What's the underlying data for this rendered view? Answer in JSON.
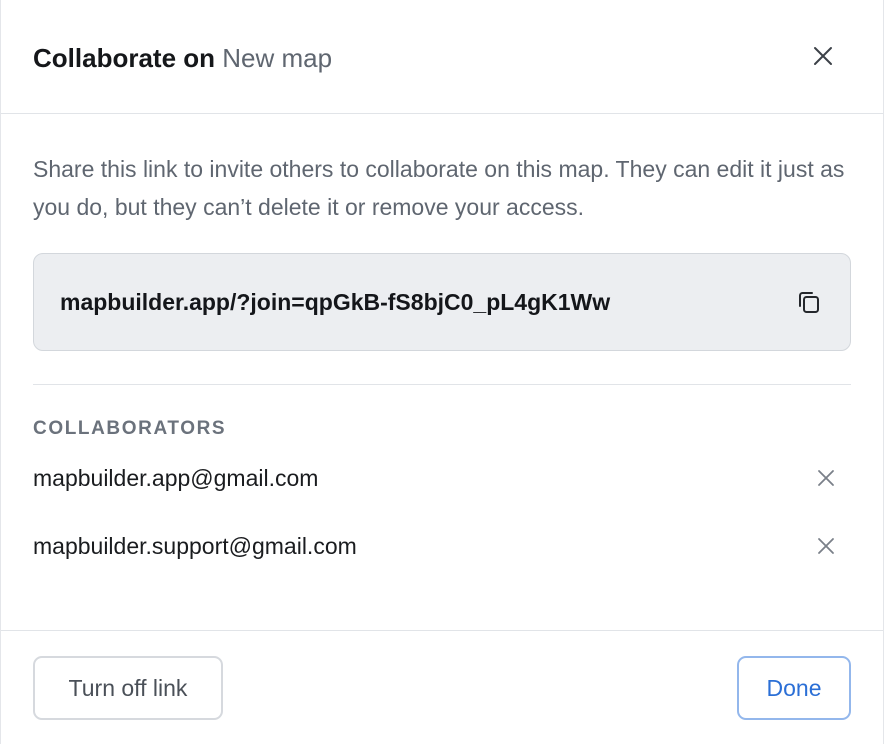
{
  "dialog": {
    "title_prefix": "Collaborate on",
    "map_name": "New map",
    "description": "Share this link to invite others to collaborate on this map. They can edit it just as you do, but they can’t delete it or remove your access.",
    "share_link": "mapbuilder.app/?join=qpGkB-fS8bjC0_pL4gK1Ww",
    "collaborators_heading": "COLLABORATORS",
    "collaborators": [
      {
        "email": "mapbuilder.app@gmail.com"
      },
      {
        "email": "mapbuilder.support@gmail.com"
      }
    ],
    "turn_off_label": "Turn off link",
    "done_label": "Done"
  },
  "icons": {
    "close": "close-icon",
    "copy": "copy-icon",
    "remove": "remove-icon"
  },
  "colors": {
    "primary": "#2b6fd6",
    "primary_border": "#93b7ec",
    "link_box_bg": "#eceef1",
    "muted_text": "#5f6670"
  }
}
